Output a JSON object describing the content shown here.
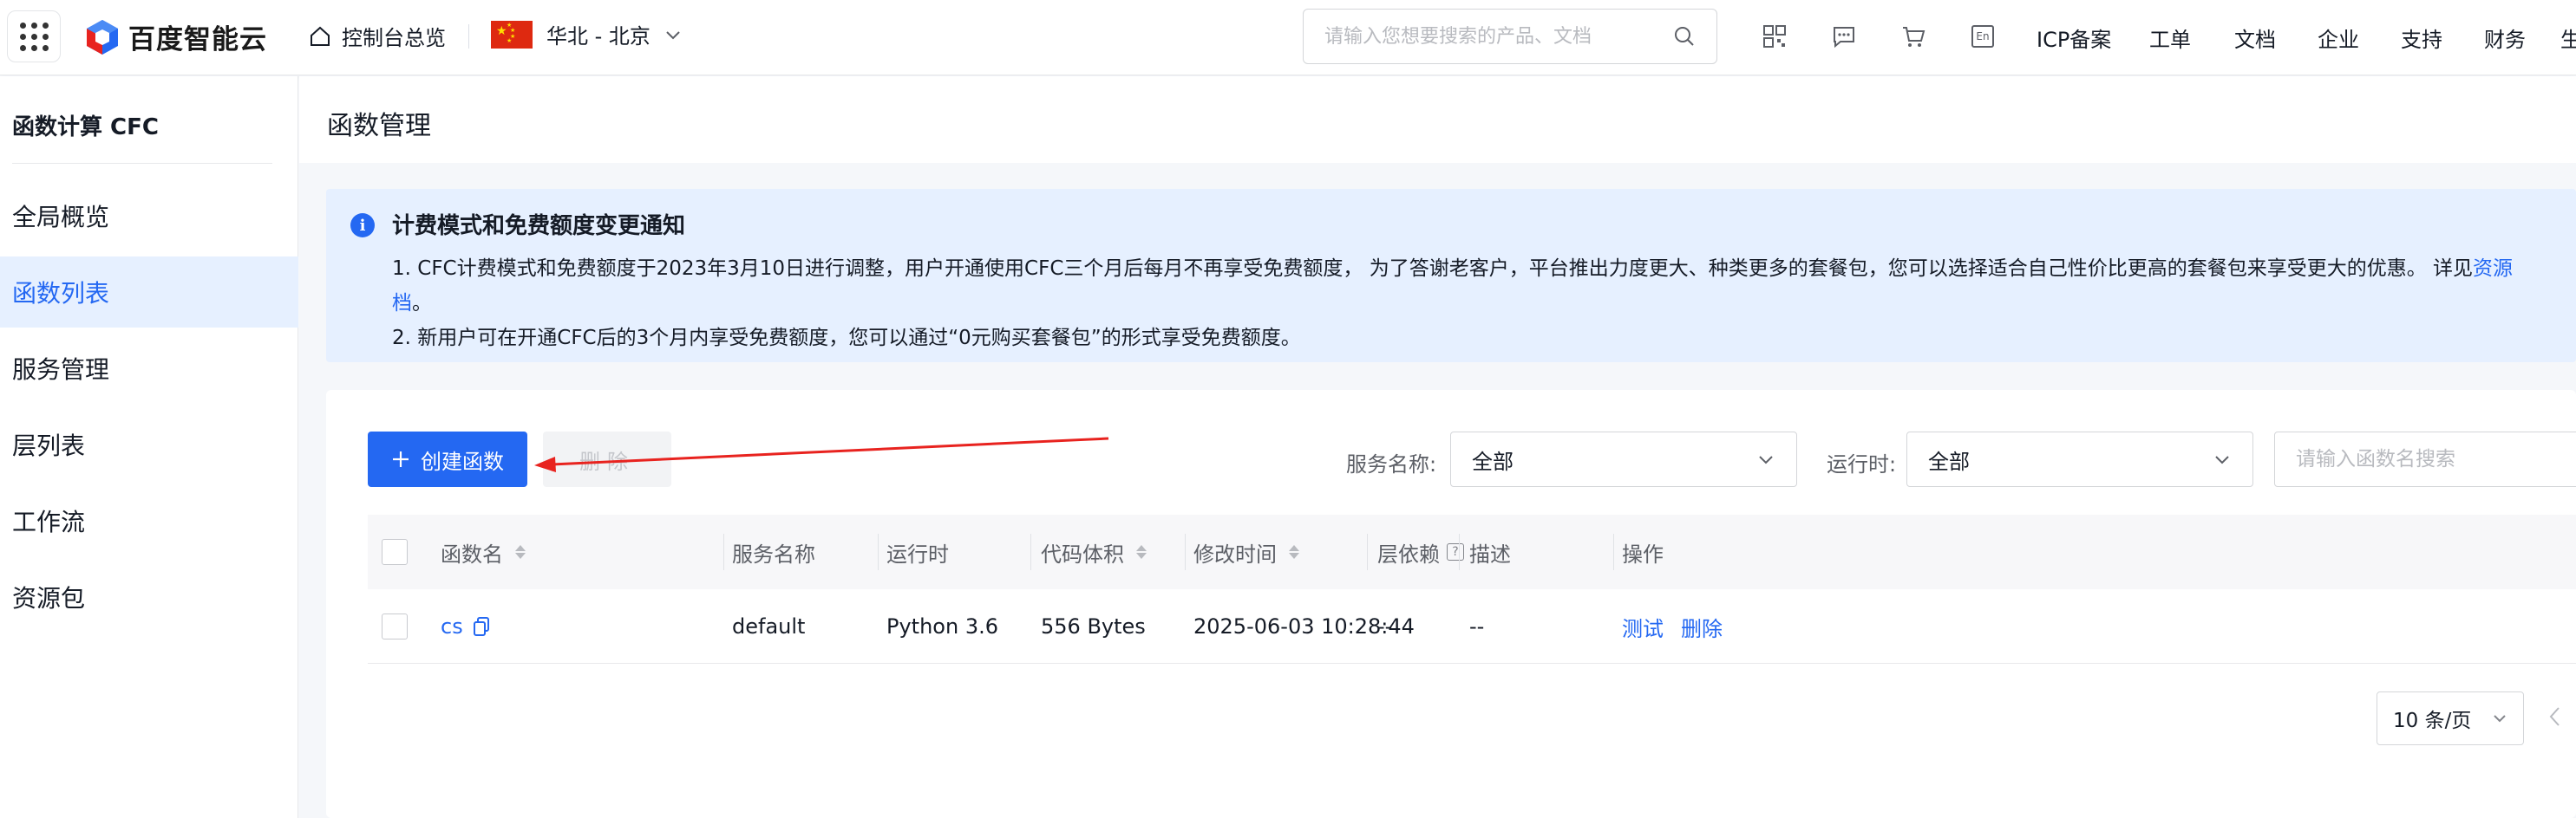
{
  "topbar": {
    "brand": "百度智能云",
    "home_label": "控制台总览",
    "region_label": "华北 - 北京",
    "search_placeholder": "请输入您想要搜索的产品、文档",
    "icons": [
      "qrcode-icon",
      "message-icon",
      "cart-icon",
      "language-en-icon"
    ],
    "lang_label": "En",
    "links": [
      "ICP备案",
      "工单",
      "文档",
      "企业",
      "支持",
      "财务",
      "生"
    ]
  },
  "sidebar": {
    "title": "函数计算 CFC",
    "items": [
      {
        "label": "全局概览",
        "active": false
      },
      {
        "label": "函数列表",
        "active": true
      },
      {
        "label": "服务管理",
        "active": false
      },
      {
        "label": "层列表",
        "active": false
      },
      {
        "label": "工作流",
        "active": false
      },
      {
        "label": "资源包",
        "active": false
      }
    ]
  },
  "page": {
    "title": "函数管理"
  },
  "notice": {
    "title": "计费模式和免费额度变更通知",
    "line1": "1. CFC计费模式和免费额度于2023年3月10日进行调整，用户开通使用CFC三个月后每月不再享受免费额度， 为了答谢老客户，平台推出力度更大、种类更多的套餐包，您可以选择适合自己性价比更高的套餐包来享受更大的优惠。 详见",
    "line1_link": "资源",
    "line2_link": "档",
    "line2_tail": "。",
    "line3": "2. 新用户可在开通CFC后的3个月内享受免费额度，您可以通过“0元购买套餐包”的形式享受免费额度。"
  },
  "toolbar": {
    "create_label": "创建函数",
    "delete_label": "删除",
    "service_filter_label": "服务名称:",
    "service_filter_value": "全部",
    "runtime_filter_label": "运行时:",
    "runtime_filter_value": "全部",
    "name_search_placeholder": "请输入函数名搜索"
  },
  "table": {
    "headers": {
      "name": "函数名",
      "service": "服务名称",
      "runtime": "运行时",
      "size": "代码体积",
      "modified": "修改时间",
      "layers": "层依赖",
      "desc": "描述",
      "actions": "操作"
    },
    "rows": [
      {
        "name": "cs",
        "service": "default",
        "runtime": "Python 3.6",
        "size": "556 Bytes",
        "modified": "2025-06-03 10:28:44",
        "layers": "--",
        "desc": "--",
        "action_test": "测试",
        "action_delete": "删除"
      }
    ]
  },
  "pagination": {
    "page_size": "10 条/页"
  },
  "colors": {
    "primary": "#2468f2",
    "active_bg": "#e6f0ff",
    "annotation_arrow": "#e8231f"
  }
}
